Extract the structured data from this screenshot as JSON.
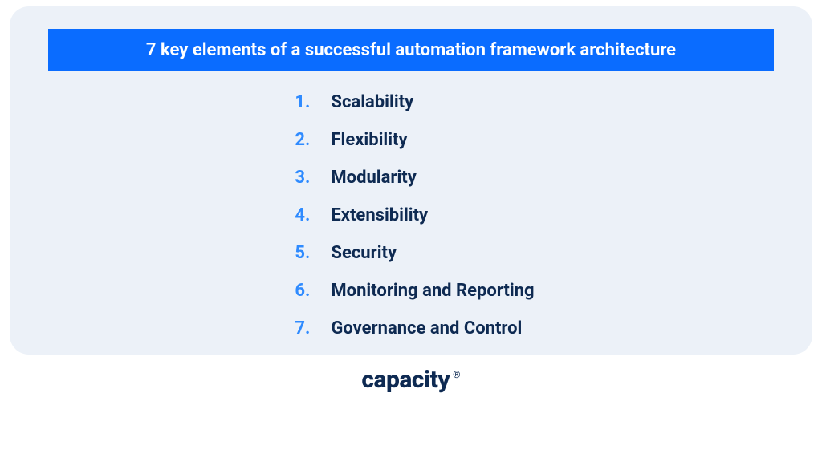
{
  "title": "7 key elements of a successful automation framework architecture",
  "items": [
    {
      "num": "1.",
      "text": "Scalability"
    },
    {
      "num": "2.",
      "text": "Flexibility"
    },
    {
      "num": "3.",
      "text": "Modularity"
    },
    {
      "num": "4.",
      "text": "Extensibility"
    },
    {
      "num": "5.",
      "text": "Security"
    },
    {
      "num": "6.",
      "text": "Monitoring and Reporting"
    },
    {
      "num": "7.",
      "text": "Governance and Control"
    }
  ],
  "brand": {
    "name": "capacity",
    "mark": "®"
  }
}
